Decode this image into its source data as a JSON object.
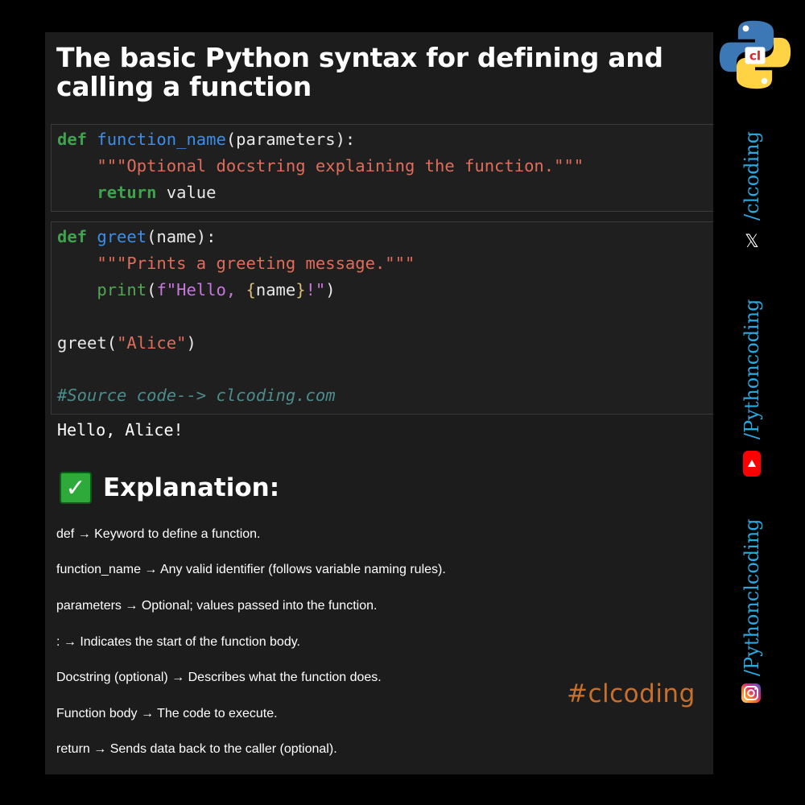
{
  "title": "The basic Python syntax for defining and calling a function",
  "code_block_1": {
    "line1": {
      "kw": "def",
      "fn": "function_name",
      "rest": "(parameters):"
    },
    "line2": {
      "doc": "\"\"\"Optional docstring explaining the function.\"\"\""
    },
    "line3": {
      "kw": "return",
      "rest": "value"
    }
  },
  "code_block_2": {
    "line1": {
      "kw": "def",
      "fn": "greet",
      "rest": "(name):"
    },
    "line2": {
      "doc": "\"\"\"Prints a greeting message.\"\"\""
    },
    "line3": {
      "builtin": "print",
      "p1": "(",
      "fpre": "f\"Hello, ",
      "lb": "{",
      "var": "name",
      "rb": "}",
      "fpost": "!\"",
      "p2": ")"
    },
    "line4": {
      "call": "greet(",
      "arg": "\"Alice\"",
      "close": ")"
    },
    "line5": {
      "comment": "#Source code--> clcoding.com"
    }
  },
  "output": "Hello, Alice!",
  "explanation": {
    "check": "✓",
    "heading": "Explanation:",
    "items": [
      "def → Keyword to define a function.",
      "function_name → Any valid identifier (follows variable naming rules).",
      "parameters → Optional; values passed into the function.",
      ": → Indicates the start of the function body.",
      "Docstring (optional) → Describes what the function does.",
      "Function body → The code to execute.",
      "return → Sends data back to the caller (optional)."
    ]
  },
  "hashtag": "#clcoding",
  "sidebar": {
    "x_handle": "/clcoding",
    "x_icon": "𝕏",
    "youtube_handle": "/Pythoncoding",
    "instagram_handle": "/Pythonclcoding"
  },
  "colors": {
    "keyword": "#3fa34d",
    "function": "#3b8eea",
    "string": "#e06c5a",
    "comment": "#4e8c8c",
    "hashtag": "#c7702e",
    "handle": "#29a9e0"
  }
}
